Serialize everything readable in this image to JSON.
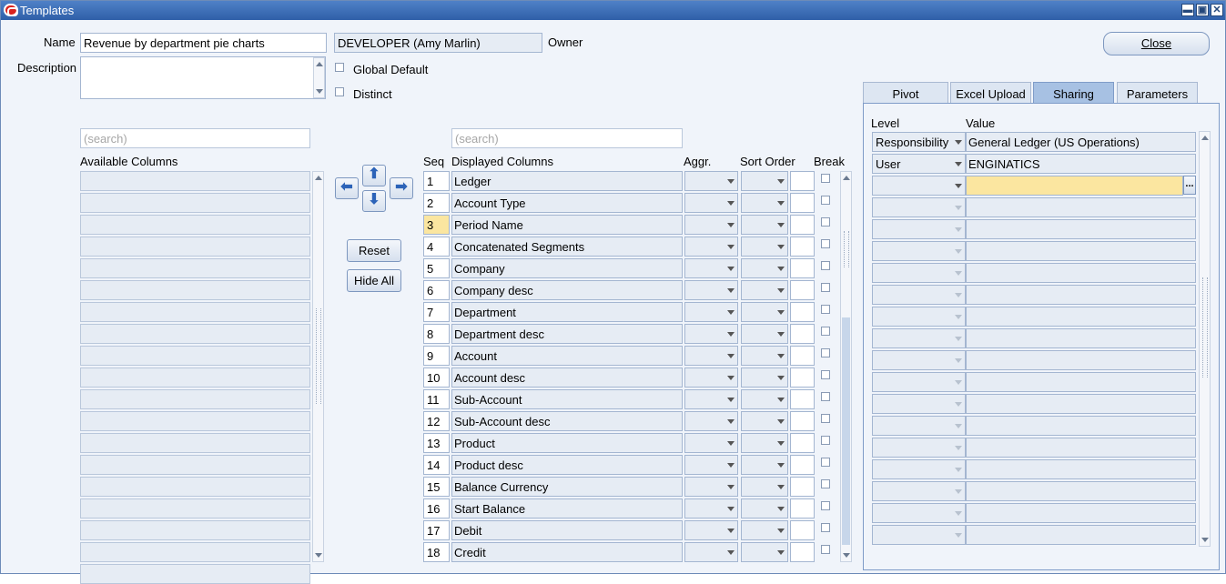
{
  "window": {
    "title": "Templates",
    "minimize": "▬",
    "maximize": "▣",
    "close": "✕"
  },
  "form": {
    "name_label": "Name",
    "name_value": "Revenue by department pie charts",
    "owner_value": "DEVELOPER (Amy Marlin)",
    "owner_label": "Owner",
    "description_label": "Description",
    "description_value": "",
    "global_default_label": "Global Default",
    "distinct_label": "Distinct",
    "close_button": "Close"
  },
  "available": {
    "search_placeholder": "(search)",
    "header": "Available Columns",
    "rows": [
      "",
      "",
      "",
      "",
      "",
      "",
      "",
      "",
      "",
      "",
      "",
      "",
      "",
      "",
      "",
      "",
      "",
      "",
      ""
    ]
  },
  "controls": {
    "reset": "Reset",
    "hide_all": "Hide All"
  },
  "displayed": {
    "search_placeholder": "(search)",
    "headers": {
      "seq": "Seq",
      "column": "Displayed Columns",
      "aggr": "Aggr.",
      "sort": "Sort Order",
      "break": "Break"
    },
    "rows": [
      {
        "seq": "1",
        "name": "Ledger"
      },
      {
        "seq": "2",
        "name": "Account Type"
      },
      {
        "seq": "3",
        "name": "Period Name"
      },
      {
        "seq": "4",
        "name": "Concatenated Segments"
      },
      {
        "seq": "5",
        "name": "Company"
      },
      {
        "seq": "6",
        "name": "Company desc"
      },
      {
        "seq": "7",
        "name": "Department"
      },
      {
        "seq": "8",
        "name": "Department desc"
      },
      {
        "seq": "9",
        "name": "Account"
      },
      {
        "seq": "10",
        "name": "Account desc"
      },
      {
        "seq": "11",
        "name": "Sub-Account"
      },
      {
        "seq": "12",
        "name": "Sub-Account desc"
      },
      {
        "seq": "13",
        "name": "Product"
      },
      {
        "seq": "14",
        "name": "Product desc"
      },
      {
        "seq": "15",
        "name": "Balance Currency"
      },
      {
        "seq": "16",
        "name": "Start Balance"
      },
      {
        "seq": "17",
        "name": "Debit"
      },
      {
        "seq": "18",
        "name": "Credit"
      }
    ]
  },
  "tabs": [
    {
      "label": "Pivot",
      "active": false
    },
    {
      "label": "Excel Upload",
      "active": false
    },
    {
      "label": "Sharing",
      "active": true
    },
    {
      "label": "Parameters",
      "active": false
    }
  ],
  "sharing": {
    "level_header": "Level",
    "value_header": "Value",
    "rows": [
      {
        "level": "Responsibility",
        "value": "General Ledger (US Operations)"
      },
      {
        "level": "User",
        "value": "ENGINATICS"
      },
      {
        "level": "",
        "value": ""
      },
      {
        "level": "",
        "value": ""
      },
      {
        "level": "",
        "value": ""
      },
      {
        "level": "",
        "value": ""
      },
      {
        "level": "",
        "value": ""
      },
      {
        "level": "",
        "value": ""
      },
      {
        "level": "",
        "value": ""
      },
      {
        "level": "",
        "value": ""
      },
      {
        "level": "",
        "value": ""
      },
      {
        "level": "",
        "value": ""
      },
      {
        "level": "",
        "value": ""
      },
      {
        "level": "",
        "value": ""
      },
      {
        "level": "",
        "value": ""
      },
      {
        "level": "",
        "value": ""
      },
      {
        "level": "",
        "value": ""
      },
      {
        "level": "",
        "value": ""
      },
      {
        "level": "",
        "value": ""
      }
    ],
    "lov_button": "..."
  },
  "colors": {
    "titlebar": "#2f5fa8",
    "current_field": "#fbe6a0",
    "background": "#f0f4fa"
  }
}
